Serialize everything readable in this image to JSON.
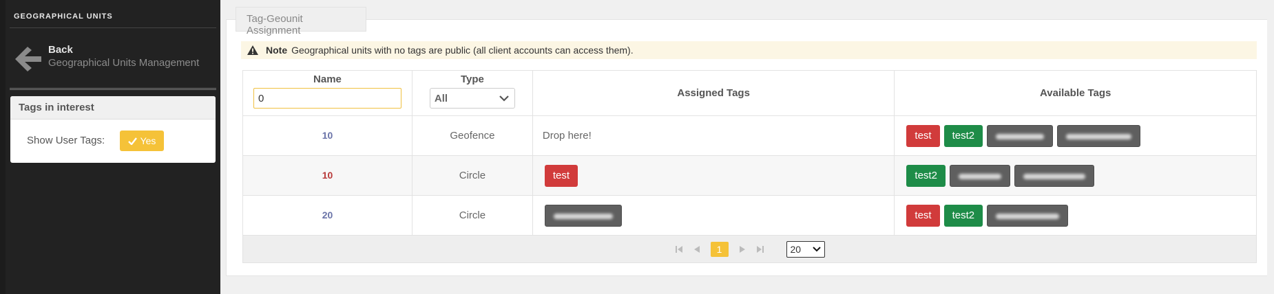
{
  "sidebar": {
    "heading": "GEOGRAPHICAL UNITS",
    "back": {
      "title": "Back",
      "subtitle": "Geographical Units Management"
    },
    "panel": {
      "title": "Tags in interest",
      "show_user_tags_label": "Show User Tags:",
      "toggle_label": "Yes"
    }
  },
  "main": {
    "tab_title": "Tag-Geounit Assignment",
    "note": {
      "label": "Note",
      "text": "Geographical units with no tags are public (all client accounts can access them)."
    },
    "table": {
      "headers": {
        "name": "Name",
        "type": "Type",
        "assigned": "Assigned Tags",
        "available": "Available Tags"
      },
      "filters": {
        "name_value": "0",
        "type_value": "All"
      },
      "drop_hint": "Drop here!",
      "rows": [
        {
          "name": "10",
          "type": "Geofence"
        },
        {
          "name": "10",
          "type": "Circle"
        },
        {
          "name": "20",
          "type": "Circle"
        }
      ],
      "tags": {
        "test": "test",
        "test2": "test2"
      }
    },
    "pager": {
      "current_page": "1",
      "page_size": "20"
    }
  },
  "colors": {
    "accent": "#f5c238",
    "tag_red": "#d13b3b",
    "tag_green": "#1e8c48",
    "tag_gray": "#5f5f5f",
    "sidebar": "#222222"
  },
  "icons": [
    "arrow-left-icon",
    "check-icon",
    "warning-icon",
    "chevron-down-icon",
    "first-page-icon",
    "prev-page-icon",
    "next-page-icon",
    "last-page-icon"
  ]
}
